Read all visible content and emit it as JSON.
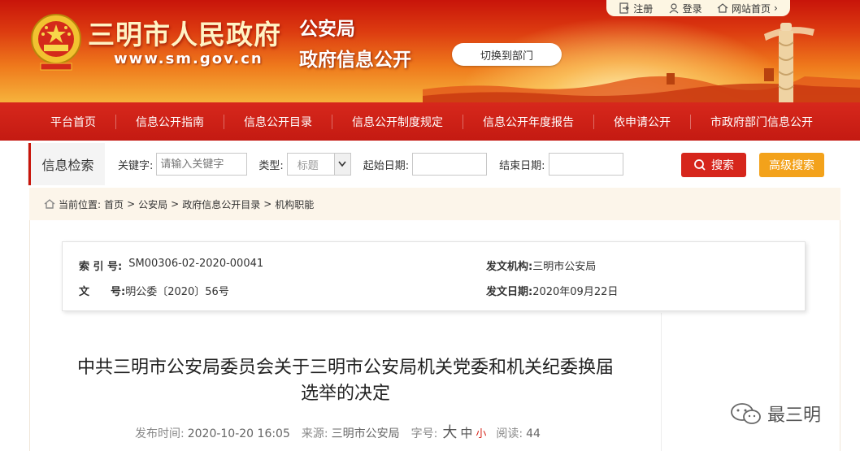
{
  "header": {
    "site_name": "三明市人民政府",
    "site_url": "www.sm.gov.cn",
    "department": "公安局",
    "section": "政府信息公开",
    "switch_label": "切换到部门"
  },
  "user_bar": {
    "register": "注册",
    "login": "登录",
    "home": "网站首页"
  },
  "nav": {
    "items": [
      {
        "label": "平台首页"
      },
      {
        "label": "信息公开指南"
      },
      {
        "label": "信息公开目录"
      },
      {
        "label": "信息公开制度规定"
      },
      {
        "label": "信息公开年度报告"
      },
      {
        "label": "依申请公开"
      },
      {
        "label": "市政府部门信息公开"
      }
    ]
  },
  "search": {
    "title": "信息检索",
    "keyword_label": "关键字:",
    "keyword_placeholder": "请输入关键字",
    "type_label": "类型:",
    "type_value": "标题",
    "start_label": "起始日期:",
    "end_label": "结束日期:",
    "search_button": "搜索",
    "advanced_button": "高级搜索"
  },
  "breadcrumb": {
    "prefix": "当前位置:",
    "items": [
      "首页",
      "公安局",
      "政府信息公开目录",
      "机构职能"
    ],
    "separator": ">"
  },
  "meta": {
    "index_label": "索 引 号:",
    "index_value": "SM00306-02-2020-00041",
    "issuer_label": "发文机构:",
    "issuer_value": "三明市公安局",
    "docno_label": "文　　号:",
    "docno_value": "明公委〔2020〕56号",
    "date_label": "发文日期:",
    "date_value": "2020年09月22日"
  },
  "article": {
    "title_line1": "中共三明市公安局委员会关于三明市公安局机关党委和机关纪委换届",
    "title_line2": "选举的决定",
    "publish_label": "发布时间:",
    "publish_value": "2020-10-20 16:05",
    "source_label": "来源:",
    "source_value": "三明市公安局",
    "fontsize_label": "字号:",
    "fs_big": "大",
    "fs_mid": "中",
    "fs_small": "小",
    "reads_label": "阅读:",
    "reads_value": "44"
  },
  "watermark": {
    "text": "最三明"
  },
  "colors": {
    "primary_red": "#d6261c",
    "nav_red": "#c41a12",
    "advanced_orange": "#f3a21b",
    "breadcrumb_bg": "#fcf5ea"
  }
}
